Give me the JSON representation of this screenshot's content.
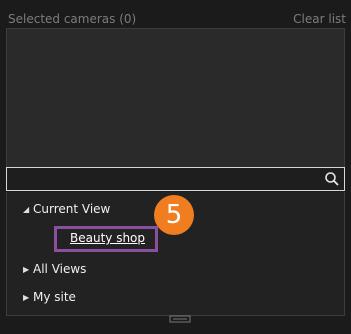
{
  "header": {
    "title": "Selected cameras (0)",
    "clear_label": "Clear list"
  },
  "search": {
    "value": "",
    "placeholder": ""
  },
  "tree": {
    "current_view": "Current View",
    "selected_item": "Beauty shop",
    "all_views": "All Views",
    "my_site": "My site"
  },
  "step_badge": "5",
  "colors": {
    "highlight_border": "#8b4fa0",
    "badge": "#f07d1f"
  },
  "icons": [
    "search-icon",
    "expanded-arrow-icon",
    "collapsed-arrow-icon",
    "resize-grip-icon"
  ]
}
